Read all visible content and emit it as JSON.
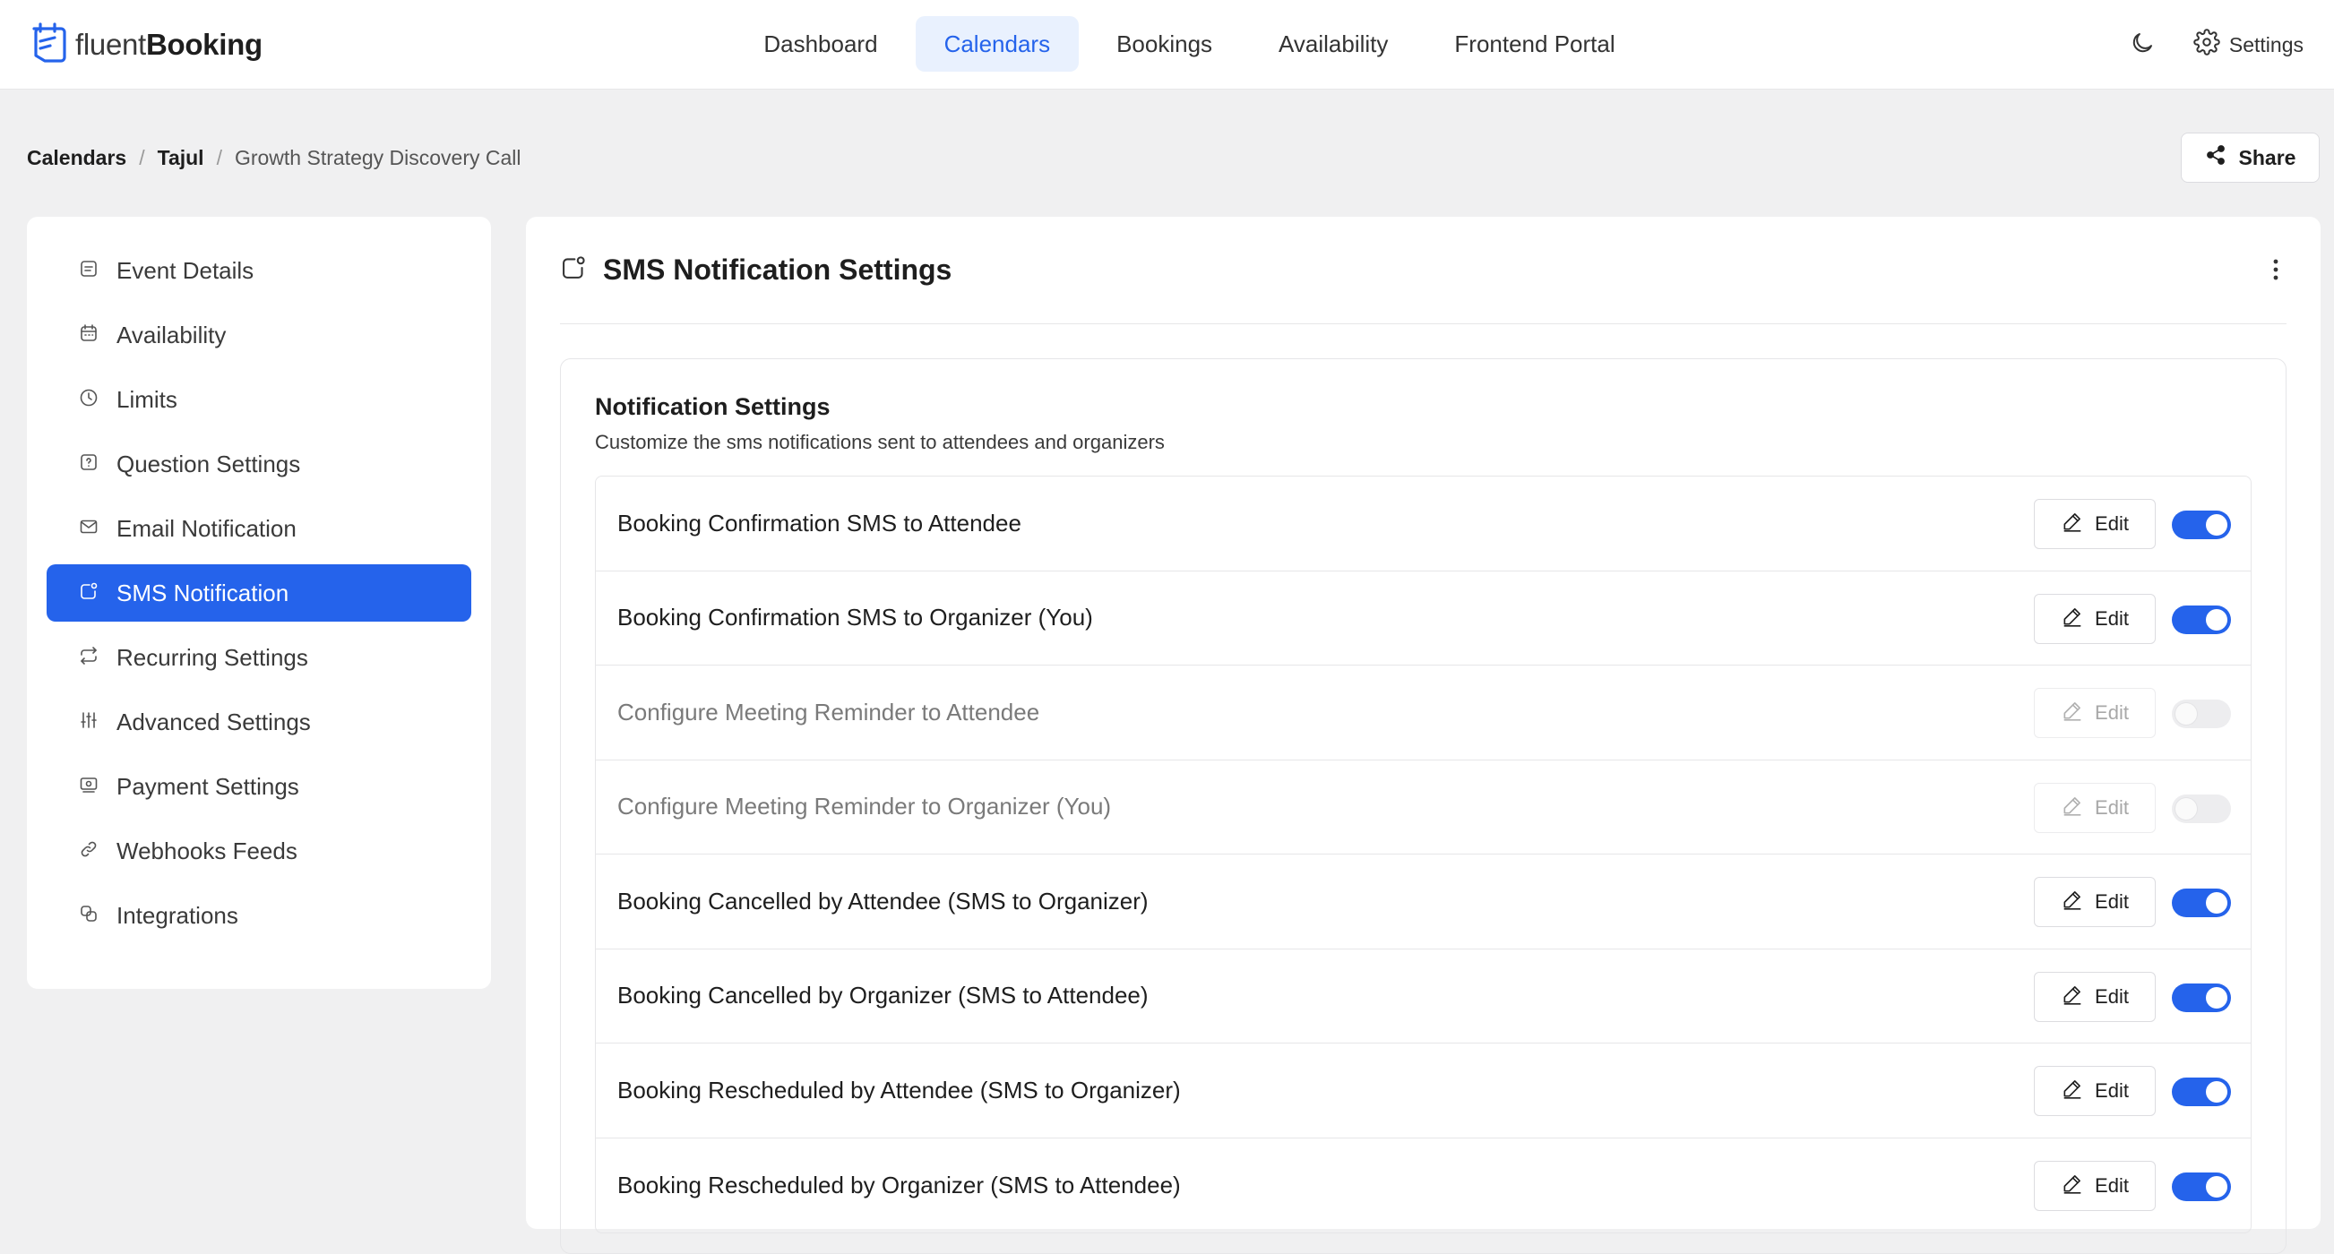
{
  "brand": {
    "name_light": "fluent",
    "name_bold": "Booking",
    "accent_color": "#2563eb",
    "logo_icon": "calendar-logo-icon"
  },
  "nav": {
    "items": [
      {
        "label": "Dashboard",
        "active": false
      },
      {
        "label": "Calendars",
        "active": true
      },
      {
        "label": "Bookings",
        "active": false
      },
      {
        "label": "Availability",
        "active": false
      },
      {
        "label": "Frontend Portal",
        "active": false
      }
    ]
  },
  "top_right": {
    "theme_icon": "moon-icon",
    "settings_icon": "gear-icon",
    "settings_label": "Settings"
  },
  "breadcrumb": {
    "items": [
      "Calendars",
      "Tajul",
      "Growth Strategy Discovery Call"
    ],
    "separator": "/"
  },
  "share": {
    "label": "Share",
    "icon": "share-icon"
  },
  "sidebar": {
    "items": [
      {
        "label": "Event Details",
        "icon": "event-details-icon",
        "active": false
      },
      {
        "label": "Availability",
        "icon": "calendar-icon",
        "active": false
      },
      {
        "label": "Limits",
        "icon": "clock-icon",
        "active": false
      },
      {
        "label": "Question Settings",
        "icon": "question-icon",
        "active": false
      },
      {
        "label": "Email Notification",
        "icon": "envelope-icon",
        "active": false
      },
      {
        "label": "SMS Notification",
        "icon": "sms-icon",
        "active": true
      },
      {
        "label": "Recurring Settings",
        "icon": "repeat-icon",
        "active": false
      },
      {
        "label": "Advanced Settings",
        "icon": "sliders-icon",
        "active": false
      },
      {
        "label": "Payment Settings",
        "icon": "payment-icon",
        "active": false
      },
      {
        "label": "Webhooks Feeds",
        "icon": "link-icon",
        "active": false
      },
      {
        "label": "Integrations",
        "icon": "integrations-icon",
        "active": false
      }
    ]
  },
  "panel": {
    "title": "SMS Notification Settings",
    "icon": "sms-icon",
    "menu_icon": "kebab-icon"
  },
  "notification_card": {
    "title": "Notification Settings",
    "subtitle": "Customize the sms notifications sent to attendees and organizers",
    "edit_label": "Edit",
    "edit_icon": "pencil-icon",
    "rows": [
      {
        "label": "Booking Confirmation SMS to Attendee",
        "enabled": true
      },
      {
        "label": "Booking Confirmation SMS to Organizer (You)",
        "enabled": true
      },
      {
        "label": "Configure Meeting Reminder to Attendee",
        "enabled": false
      },
      {
        "label": "Configure Meeting Reminder to Organizer (You)",
        "enabled": false
      },
      {
        "label": "Booking Cancelled by Attendee (SMS to Organizer)",
        "enabled": true
      },
      {
        "label": "Booking Cancelled by Organizer (SMS to Attendee)",
        "enabled": true
      },
      {
        "label": "Booking Rescheduled by Attendee (SMS to Organizer)",
        "enabled": true
      },
      {
        "label": "Booking Rescheduled by Organizer (SMS to Attendee)",
        "enabled": true
      }
    ]
  }
}
